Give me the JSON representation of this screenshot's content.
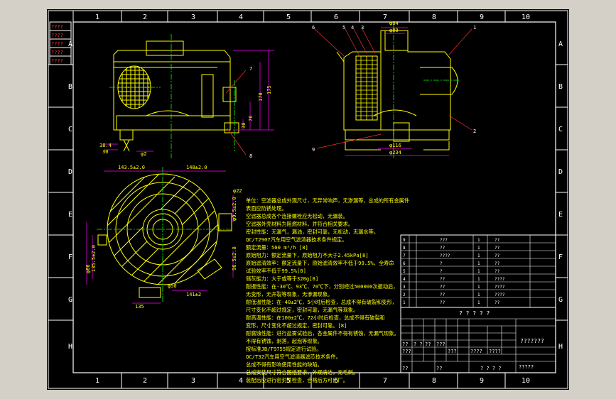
{
  "drawing": {
    "zones_top": [
      "1",
      "2",
      "3",
      "4",
      "5",
      "6",
      "7",
      "8",
      "9",
      "10"
    ],
    "zones_bottom": [
      "1",
      "2",
      "3",
      "4",
      "5",
      "6",
      "7",
      "8",
      "9",
      "10"
    ],
    "zones_left": [
      "A",
      "B",
      "C",
      "D",
      "E",
      "F",
      "G",
      "H"
    ],
    "zones_right": [
      "A",
      "B",
      "C",
      "D",
      "E",
      "F",
      "G",
      "H"
    ],
    "left_strip": [
      "????",
      "????",
      "????",
      "????",
      "????"
    ],
    "side_view": {
      "dims": [
        "175",
        "170",
        "76",
        "30",
        "38.4",
        "30",
        "φ2"
      ],
      "balloons": [
        "7",
        "8"
      ]
    },
    "section_view": {
      "dims": [
        "φ84",
        "φ80",
        "φ116",
        "φ234"
      ],
      "balloons": [
        "6",
        "5",
        "4",
        "3",
        "1",
        "2",
        "9"
      ]
    },
    "plan_view": {
      "dims": [
        "143.5±2.0",
        "148±2.0",
        "φ22",
        "φ9.5±2.0",
        "96.5±2.0",
        "141±2",
        "135.5±2.0",
        "φ86",
        "135",
        "φ50"
      ]
    },
    "notes": [
      "单位：空滤器总成外观尺寸，无异常响声，无渗漏等，总成的所有金属件",
      "表面应防锈处理。",
      "  空滤器总成各个连接螺栓应无松动，无漏装。",
      "  空滤器外壳材料为阻燃材料，并符合相关要求。",
      "  密封性能：无漏气，漏油，密封可靠，无松动，无漏水等。",
      "  QC/T2907汽车用空气滤清器技术条件规定。",
      "额定流量：500 m³/h [8]",
      "原始阻力：额定流量下，原始阻力不大于2.45kPa[8]",
      "原始滤清效率：额定流量下，原始滤清效率不低于99.5%，全寿命",
      "试验效率不低于99.5%[8]",
      "储灰能力：大于或等于320g[8]",
      "耐振性能：在-30℃、93℃、70℃下，分别经过500000次振动后，",
      "无变形，无开裂等现象，无渗漏现象。",
      "  耐低温性能：在-40±2℃，5小时后检查，总成不得有破裂和变形，",
      "  尺寸变化不超过规定，密封可靠，无漏气等现象。",
      "  耐高温性能：在100±2℃，72小时后检查，总成不得有破裂和",
      "  变形，尺寸变化不超过规定，密封可靠。[8]",
      "  耐腐蚀性能：进行盐雾试验后，各金属件不得有锈蚀，无漏气现象。",
      "  不得有锈蚀，剥落，起泡等现象。",
      "  按标准JB/T9755规定进行试验。",
      "  QC/T32汽车用空气滤清器滤芯技术条件。",
      "  总成不得有影响使用性能的缺陷。",
      "  总成安装尺寸符合图纸要求，外观清洁，无毛刺。",
      "  装配后应进行密封性检查，合格后方可出厂。"
    ],
    "bom_rows": [
      [
        "9",
        "???",
        "1",
        "??"
      ],
      [
        "8",
        "??",
        "1",
        "??"
      ],
      [
        "7",
        "????",
        "1",
        "??"
      ],
      [
        "6",
        "?",
        "1",
        "??"
      ],
      [
        "5",
        "?",
        "1",
        "??"
      ],
      [
        "4",
        "??",
        "1",
        "????"
      ],
      [
        "3",
        "??",
        "1",
        "????"
      ],
      [
        "2",
        "??",
        "1",
        "????"
      ],
      [
        "1",
        "??",
        "1",
        "??"
      ]
    ],
    "title_block": {
      "header": "? ? ? ? ?",
      "labels": [
        "??",
        "? ?",
        "??",
        "???",
        "????",
        "????",
        "???",
        "???"
      ],
      "title": "???????",
      "bottom": [
        "??",
        "??",
        "? ? ? ?"
      ],
      "code": "?????"
    }
  },
  "colors": {
    "background": "#000000",
    "frame": "#ffffff",
    "drawing": "#ffff00",
    "dimension": "#ff00ff",
    "centerline": "#00ff00",
    "leader": "#ff0000",
    "annotation": "#ffffff"
  }
}
